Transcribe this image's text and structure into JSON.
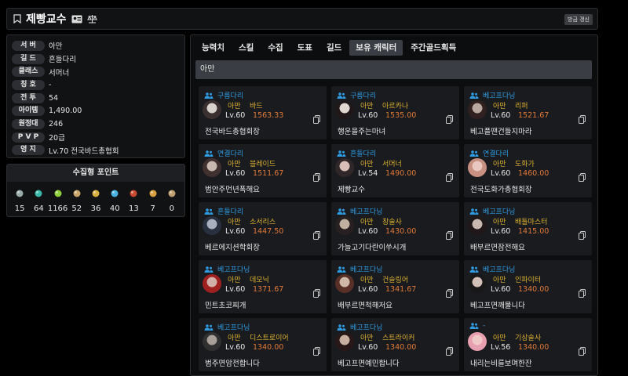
{
  "header": {
    "title": "제빵교수",
    "refresh_label": "방금 갱신"
  },
  "profile": [
    {
      "label": "서 버",
      "value": "아만"
    },
    {
      "label": "길 드",
      "value": "흔들다리"
    },
    {
      "label": "클래스",
      "value": "서머너"
    },
    {
      "label": "칭 호",
      "value": "-"
    },
    {
      "label": "전 투",
      "value": "54"
    },
    {
      "label": "아이템",
      "value": "1,490.00"
    },
    {
      "label": "원정대",
      "value": "246"
    },
    {
      "label": "P V P",
      "value": "20급"
    },
    {
      "label": "영 지",
      "value": "Lv.70 전국바드총협회"
    }
  ],
  "collection": {
    "title": "수집형 포인트",
    "items": [
      {
        "icon": "island-heart-icon",
        "value": "15",
        "color": "#9aa"
      },
      {
        "icon": "world-orb-icon",
        "value": "64",
        "color": "#3cb8a8"
      },
      {
        "icon": "mokoko-seed-icon",
        "value": "1166",
        "color": "#8fcf3c"
      },
      {
        "icon": "art-scroll-icon",
        "value": "52",
        "color": "#c9a56a"
      },
      {
        "icon": "voyage-telescope-icon",
        "value": "36",
        "color": "#d8b040"
      },
      {
        "icon": "ignea-token-icon",
        "value": "40",
        "color": "#4ab0e0"
      },
      {
        "icon": "giant-heart-icon",
        "value": "13",
        "color": "#c84a30"
      },
      {
        "icon": "star-compass-icon",
        "value": "7",
        "color": "#d8a040"
      },
      {
        "icon": "orpheus-star-icon",
        "value": "0",
        "color": "#c0a070"
      }
    ]
  },
  "tabs": [
    {
      "label": "능력치",
      "active": false
    },
    {
      "label": "스킬",
      "active": false
    },
    {
      "label": "수집",
      "active": false
    },
    {
      "label": "도표",
      "active": false
    },
    {
      "label": "길드",
      "active": false
    },
    {
      "label": "보유 캐릭터",
      "active": true
    },
    {
      "label": "주간골드획득",
      "active": false
    }
  ],
  "server_name": "아만",
  "characters": [
    {
      "guild": "구름다리",
      "server": "아만",
      "class": "바드",
      "level": "Lv.60",
      "item_level": "1563.33",
      "name": "전국바드총협회장",
      "avatar": [
        "#d8d2cc",
        "#3a3030"
      ]
    },
    {
      "guild": "구름다리",
      "server": "아만",
      "class": "아르카나",
      "level": "Lv.60",
      "item_level": "1535.00",
      "name": "행운을주는마녀",
      "avatar": [
        "#e0d8d0",
        "#201818"
      ]
    },
    {
      "guild": "베고프다닝",
      "server": "아만",
      "class": "리퍼",
      "level": "Lv.60",
      "item_level": "1521.67",
      "name": "베고플땐건들지마라",
      "avatar": [
        "#b8a8a0",
        "#302020"
      ]
    },
    {
      "guild": "연결다리",
      "server": "아만",
      "class": "블레이드",
      "level": "Lv.60",
      "item_level": "1511.67",
      "name": "범안주먼년폭해요",
      "avatar": [
        "#c8b8b0",
        "#403030"
      ]
    },
    {
      "guild": "흔들다리",
      "server": "아만",
      "class": "서머너",
      "level": "Lv.54",
      "item_level": "1490.00",
      "name": "제빵교수",
      "avatar": [
        "#d8c0b8",
        "#302828"
      ]
    },
    {
      "guild": "연결다리",
      "server": "아만",
      "class": "도화가",
      "level": "Lv.60",
      "item_level": "1460.00",
      "name": "전국도화가총협회장",
      "avatar": [
        "#e8c8c0",
        "#c89080"
      ]
    },
    {
      "guild": "흔들다리",
      "server": "아만",
      "class": "소서리스",
      "level": "Lv.60",
      "item_level": "1447.50",
      "name": "베르에지션학회장",
      "avatar": [
        "#a8b0c0",
        "#283040"
      ]
    },
    {
      "guild": "베고프다닝",
      "server": "아만",
      "class": "창술사",
      "level": "Lv.60",
      "item_level": "1430.00",
      "name": "가늘고기다란이쑤시개",
      "avatar": [
        "#c0b0a0",
        "#282020"
      ]
    },
    {
      "guild": "베고프다닝",
      "server": "아만",
      "class": "배틀마스터",
      "level": "Lv.60",
      "item_level": "1415.00",
      "name": "배부르면잠전해요",
      "avatar": [
        "#c8b8b0",
        "#201818"
      ]
    },
    {
      "guild": "베고프다닝",
      "server": "아만",
      "class": "데모닉",
      "level": "Lv.60",
      "item_level": "1371.67",
      "name": "민트초코찌개",
      "avatar": [
        "#d0b0a8",
        "#a02020"
      ]
    },
    {
      "guild": "베고프다닝",
      "server": "아만",
      "class": "건슬링어",
      "level": "Lv.60",
      "item_level": "1341.67",
      "name": "배부르면척해저요",
      "avatar": [
        "#d0b8a8",
        "#583028"
      ]
    },
    {
      "guild": "베고프다닝",
      "server": "아만",
      "class": "인파이터",
      "level": "Lv.60",
      "item_level": "1340.00",
      "name": "베고프면깨물니다",
      "avatar": [
        "#d0c0b8",
        "#181818"
      ]
    },
    {
      "guild": "베고프다닝",
      "server": "아만",
      "class": "디스트로이어",
      "level": "Lv.60",
      "item_level": "1340.00",
      "name": "범주면암전합니다",
      "avatar": [
        "#a8a098",
        "#303030"
      ]
    },
    {
      "guild": "베고프다닝",
      "server": "아만",
      "class": "스트라이커",
      "level": "Lv.60",
      "item_level": "1340.00",
      "name": "베고프면예민합니다",
      "avatar": [
        "#c8b0a0",
        "#281818"
      ]
    },
    {
      "guild": "-",
      "server": "아만",
      "class": "기상술사",
      "level": "Lv.56",
      "item_level": "1340.00",
      "name": "내리는비를보며한잔",
      "avatar": [
        "#f0c8c8",
        "#e8a0b0"
      ]
    }
  ]
}
